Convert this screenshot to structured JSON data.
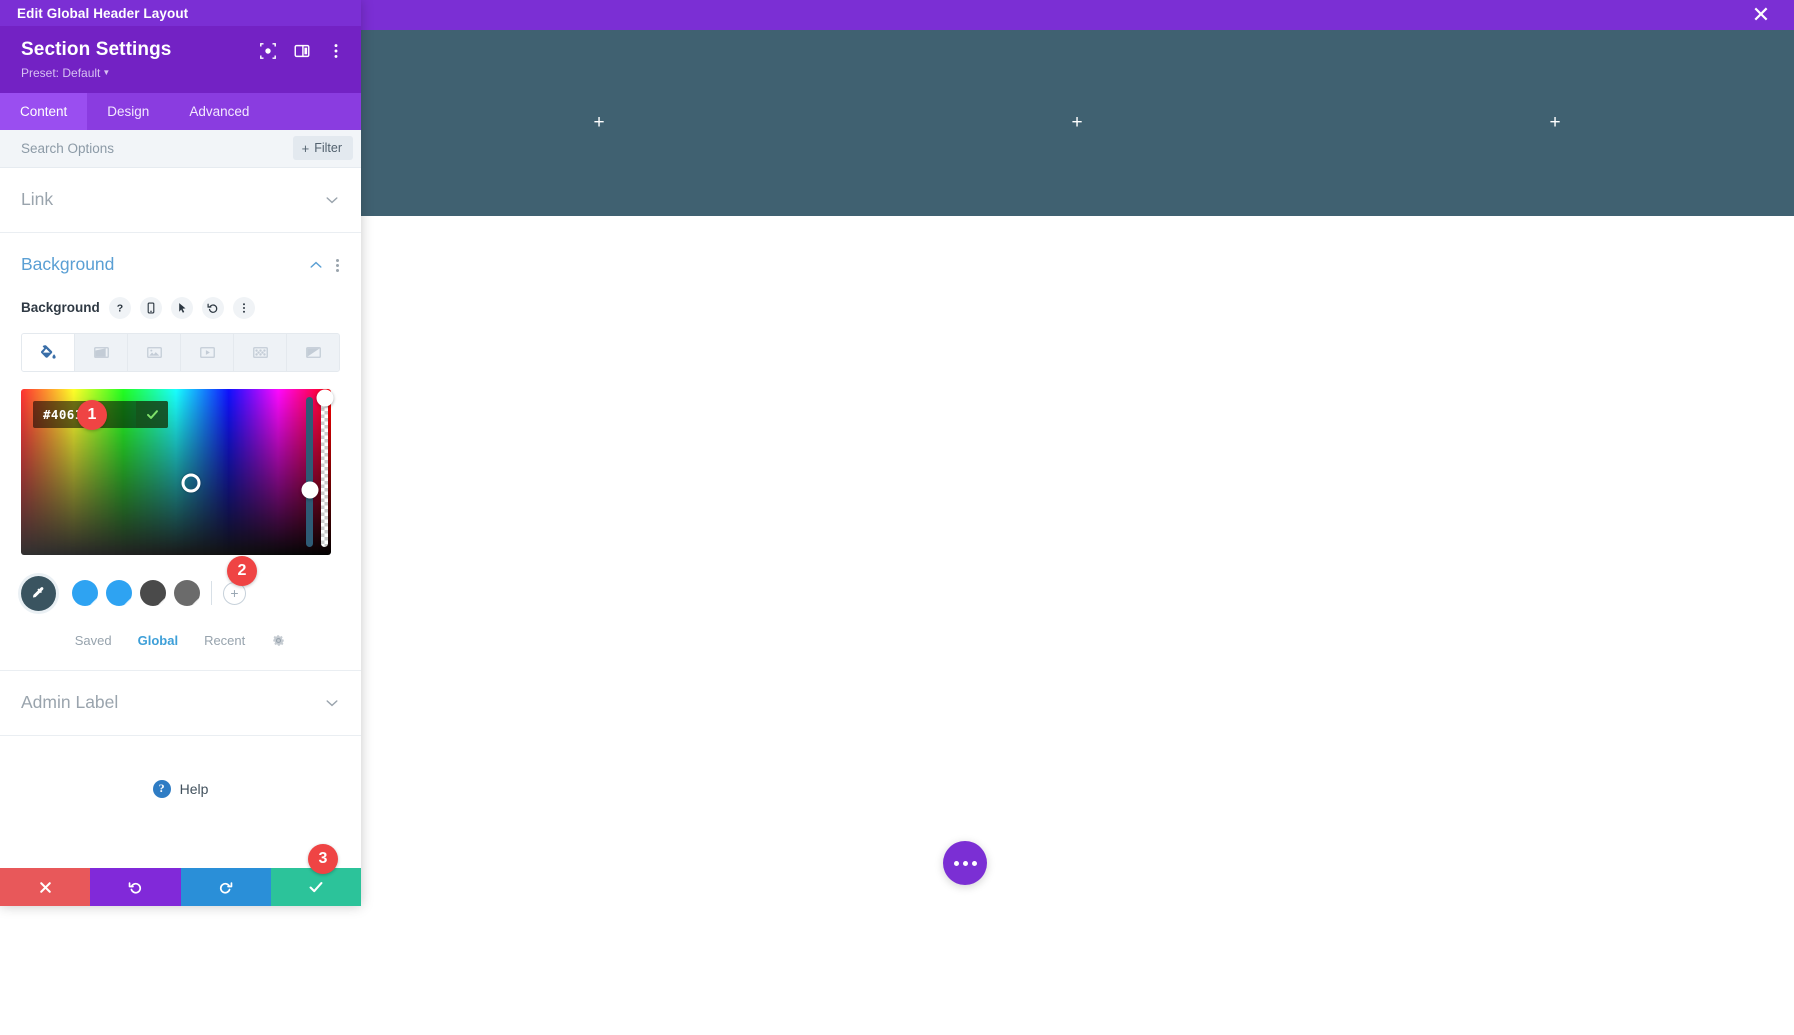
{
  "window": {
    "title": "Edit Global Header Layout",
    "close_icon": "close-icon"
  },
  "panel": {
    "heading": "Section Settings",
    "preset_label": "Preset: Default",
    "header_icons": [
      "focus-target-icon",
      "panel-layout-icon",
      "kebab-menu-icon"
    ],
    "tabs": [
      {
        "label": "Content",
        "active": true
      },
      {
        "label": "Design",
        "active": false
      },
      {
        "label": "Advanced",
        "active": false
      }
    ],
    "search": {
      "placeholder": "Search Options",
      "value": "",
      "filter_label": "Filter",
      "filter_plus": "+"
    },
    "sections": [
      {
        "label": "Link",
        "open": false
      },
      {
        "label": "Background",
        "open": true
      },
      {
        "label": "Admin Label",
        "open": false
      }
    ],
    "background": {
      "field_label": "Background",
      "field_icons": [
        "help-icon",
        "responsive-mobile-icon",
        "hover-cursor-icon",
        "reset-undo-icon",
        "kebab-menu-icon"
      ],
      "types": [
        {
          "name": "background-color",
          "active": true
        },
        {
          "name": "background-gradient",
          "active": false
        },
        {
          "name": "background-image",
          "active": false
        },
        {
          "name": "background-video",
          "active": false
        },
        {
          "name": "background-pattern",
          "active": false
        },
        {
          "name": "background-mask",
          "active": false
        }
      ],
      "hex_value": "#406171",
      "hex_confirm_icon": "checkmark-icon",
      "swatches": [
        "#2ea3f2",
        "#2ea3f2",
        "#4a4a4a",
        "#6b6b6b"
      ],
      "add_swatch_label": "+",
      "eyedropper_icon": "eyedropper-icon",
      "palette_tabs": [
        {
          "label": "Saved",
          "active": false
        },
        {
          "label": "Global",
          "active": true
        },
        {
          "label": "Recent",
          "active": false
        }
      ],
      "palette_settings_icon": "gear-icon"
    },
    "help": {
      "label": "Help",
      "badge": "?"
    },
    "actions": [
      {
        "name": "discard-changes",
        "icon": "close-x-icon",
        "color": "#e8585a"
      },
      {
        "name": "undo",
        "icon": "undo-arrow-icon",
        "color": "#8129d9"
      },
      {
        "name": "redo",
        "icon": "redo-arrow-icon",
        "color": "#2a8fd8"
      },
      {
        "name": "save-changes",
        "icon": "checkmark-icon",
        "color": "#2cc39a"
      }
    ]
  },
  "preview": {
    "section_bg_color": "#406171",
    "columns": [
      {
        "add_label": "+"
      },
      {
        "add_label": "+"
      },
      {
        "add_label": "+"
      }
    ],
    "fab_icon": "ellipsis-icon",
    "fab_color": "#7b2fd4"
  },
  "markers": [
    {
      "id": "1",
      "label": "1"
    },
    {
      "id": "2",
      "label": "2"
    },
    {
      "id": "3",
      "label": "3"
    }
  ]
}
